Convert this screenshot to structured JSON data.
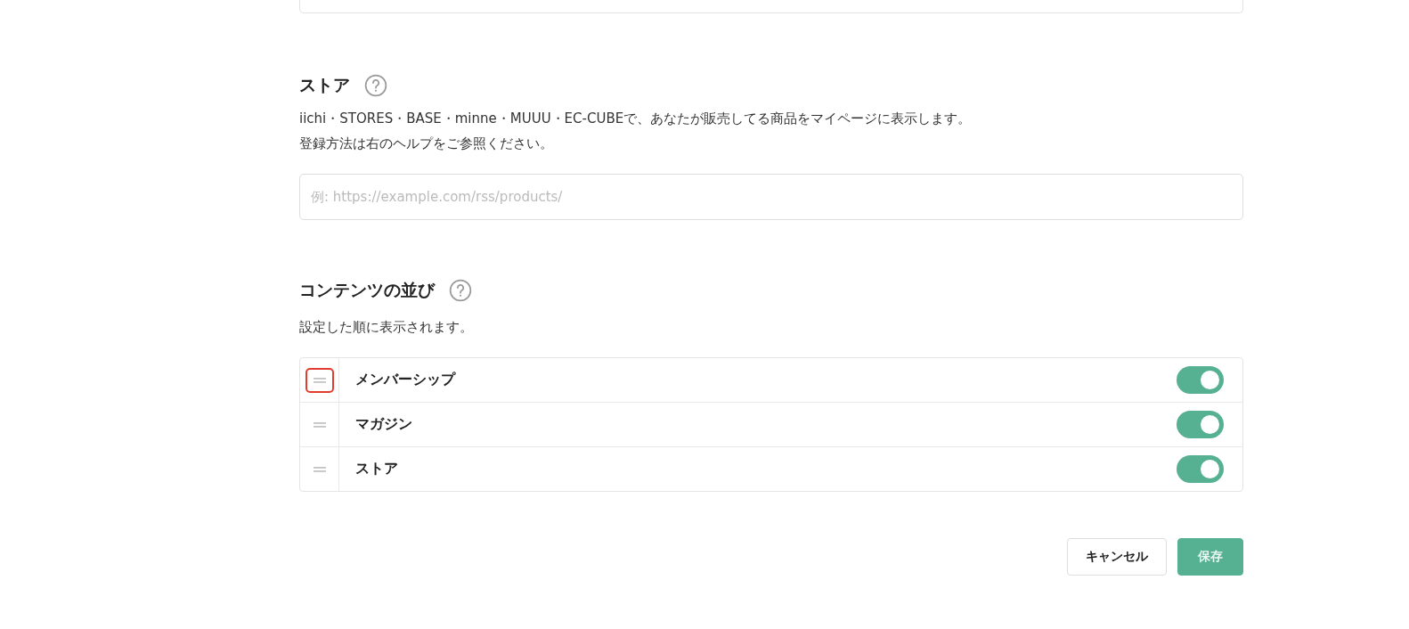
{
  "store": {
    "title": "ストア",
    "description": [
      "iichi・STORES・BASE・minne・MUUU・EC-CUBEで、あなたが販売してる商品をマイページに表示します。",
      "登録方法は右のヘルプをご参照ください。"
    ],
    "placeholder": "例: https://example.com/rss/products/"
  },
  "order": {
    "title": "コンテンツの並び",
    "description": "設定した順に表示されます。",
    "items": [
      {
        "label": "メンバーシップ",
        "on": true,
        "highlighted": true
      },
      {
        "label": "マガジン",
        "on": true,
        "highlighted": false
      },
      {
        "label": "ストア",
        "on": true,
        "highlighted": false
      }
    ]
  },
  "buttons": [
    {
      "label": "キャンセル",
      "kind": "secondary"
    },
    {
      "label": "保存",
      "kind": "primary"
    }
  ]
}
